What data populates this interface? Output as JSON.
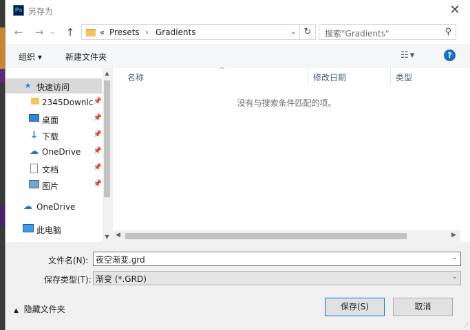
{
  "window": {
    "title": "另存为",
    "app_icon": "Ps"
  },
  "nav": {
    "back": "←",
    "forward": "→",
    "history": "⌄",
    "up": "↑",
    "breadcrumb": [
      "«",
      "Presets",
      "›",
      "Gradients"
    ],
    "refresh": "↻",
    "search_placeholder": "搜索\"Gradients\""
  },
  "toolbar": {
    "organize": "组织 ▾",
    "new_folder": "新建文件夹",
    "help": "?"
  },
  "sidebar": {
    "items": [
      {
        "label": "快速访问",
        "icon": "star-icon",
        "pinned": false,
        "selected": true
      },
      {
        "label": "2345Downlc",
        "icon": "folder-icon",
        "pinned": true
      },
      {
        "label": "桌面",
        "icon": "desktop-icon",
        "pinned": true
      },
      {
        "label": "下载",
        "icon": "download-icon",
        "pinned": true
      },
      {
        "label": "OneDrive",
        "icon": "cloud-icon",
        "pinned": true
      },
      {
        "label": "文档",
        "icon": "document-icon",
        "pinned": true
      },
      {
        "label": "图片",
        "icon": "pictures-icon",
        "pinned": true
      },
      {
        "label": "OneDrive",
        "icon": "cloud-icon",
        "pinned": false
      },
      {
        "label": "此电脑",
        "icon": "computer-icon",
        "pinned": false
      }
    ]
  },
  "files": {
    "columns": [
      "名称",
      "修改日期",
      "类型"
    ],
    "empty_message": "没有与搜索条件匹配的项。"
  },
  "form": {
    "filename_label": "文件名(N):",
    "filename_value": "夜空渐变.grd",
    "type_label": "保存类型(T):",
    "type_value": "渐变 (*.GRD)"
  },
  "footer": {
    "hide_folders": "隐藏文件夹",
    "save": "保存(S)",
    "cancel": "取消"
  },
  "colors": {
    "accent": "#0078d7",
    "help": "#1470c9",
    "folder": "#f2c55c"
  }
}
